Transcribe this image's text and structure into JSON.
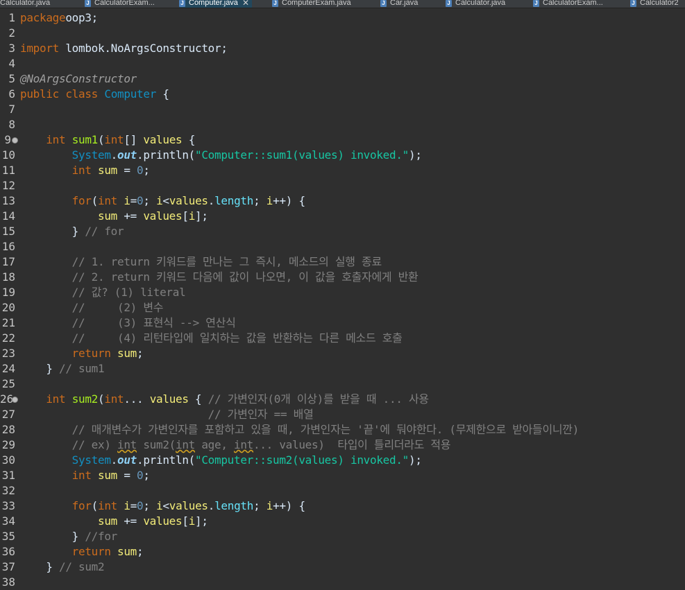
{
  "tabs": [
    {
      "label": "Calculator.java",
      "active": false,
      "icon": "java-file-icon"
    },
    {
      "label": "CalculatorExam...",
      "active": false,
      "icon": "java-file-icon"
    },
    {
      "label": "Computer.java",
      "active": true,
      "icon": "java-file-icon"
    },
    {
      "label": "ComputerExam.java",
      "active": false,
      "icon": "java-file-icon"
    },
    {
      "label": "Car.java",
      "active": false,
      "icon": "java-file-icon"
    },
    {
      "label": "Calculator.java",
      "active": false,
      "icon": "java-file-icon"
    },
    {
      "label": "CalculatorExam...",
      "active": false,
      "icon": "java-file-icon"
    },
    {
      "label": "Calculator2",
      "active": false,
      "icon": "java-file-icon"
    }
  ],
  "close_glyph": "✕",
  "colors": {
    "background": "#2f2f2f",
    "keyword": "#cc6c1d",
    "type": "#1290c3",
    "string": "#17c6a3",
    "comment": "#808080",
    "active_tab": "#22475c"
  },
  "editor": {
    "lines": [
      {
        "n": "1",
        "segs": [
          [
            "kw",
            "package"
          ],
          [
            "",
            "oop3;"
          ]
        ]
      },
      {
        "n": "2",
        "segs": []
      },
      {
        "n": "3",
        "segs": [
          [
            "kw",
            "import"
          ],
          [
            "",
            " lombok.NoArgsConstructor;"
          ]
        ]
      },
      {
        "n": "4",
        "segs": []
      },
      {
        "n": "5",
        "segs": [
          [
            "an",
            "@NoArgsConstructor"
          ]
        ]
      },
      {
        "n": "6",
        "segs": [
          [
            "kw",
            "public"
          ],
          [
            "",
            " "
          ],
          [
            "kw",
            "class"
          ],
          [
            "",
            " "
          ],
          [
            "ty",
            "Computer"
          ],
          [
            "",
            " {"
          ]
        ]
      },
      {
        "n": "7",
        "segs": []
      },
      {
        "n": "8",
        "segs": []
      },
      {
        "n": "9",
        "fold": true,
        "segs": [
          [
            "",
            "    "
          ],
          [
            "kw",
            "int"
          ],
          [
            "",
            " "
          ],
          [
            "mth",
            "sum1"
          ],
          [
            "",
            "("
          ],
          [
            "kw",
            "int"
          ],
          [
            "",
            "[] "
          ],
          [
            "var",
            "values"
          ],
          [
            "",
            " {"
          ]
        ]
      },
      {
        "n": "10",
        "segs": [
          [
            "",
            "        "
          ],
          [
            "ty",
            "System"
          ],
          [
            "",
            "."
          ],
          [
            "sfld",
            "out"
          ],
          [
            "",
            ".println("
          ],
          [
            "str",
            "\"Computer::sum1(values) invoked.\""
          ],
          [
            "",
            ");"
          ]
        ]
      },
      {
        "n": "11",
        "segs": [
          [
            "",
            "        "
          ],
          [
            "kw",
            "int"
          ],
          [
            "",
            " "
          ],
          [
            "var",
            "sum"
          ],
          [
            "",
            " = "
          ],
          [
            "num",
            "0"
          ],
          [
            "",
            ";"
          ]
        ]
      },
      {
        "n": "12",
        "segs": []
      },
      {
        "n": "13",
        "segs": [
          [
            "",
            "        "
          ],
          [
            "kw",
            "for"
          ],
          [
            "",
            "("
          ],
          [
            "kw",
            "int"
          ],
          [
            "",
            " "
          ],
          [
            "var",
            "i"
          ],
          [
            "",
            "="
          ],
          [
            "num",
            "0"
          ],
          [
            "",
            "; "
          ],
          [
            "var",
            "i"
          ],
          [
            "",
            "<"
          ],
          [
            "var",
            "values"
          ],
          [
            "",
            "."
          ],
          [
            "fld",
            "length"
          ],
          [
            "",
            "; "
          ],
          [
            "var",
            "i"
          ],
          [
            "",
            "++) {"
          ]
        ]
      },
      {
        "n": "14",
        "segs": [
          [
            "",
            "            "
          ],
          [
            "var",
            "sum"
          ],
          [
            "",
            " += "
          ],
          [
            "var",
            "values"
          ],
          [
            "",
            "["
          ],
          [
            "var",
            "i"
          ],
          [
            "",
            "];"
          ]
        ]
      },
      {
        "n": "15",
        "segs": [
          [
            "",
            "        } "
          ],
          [
            "cm",
            "// for"
          ]
        ]
      },
      {
        "n": "16",
        "segs": []
      },
      {
        "n": "17",
        "segs": [
          [
            "",
            "        "
          ],
          [
            "cm",
            "// 1. return 키워드를 만나는 그 즉시, 메소드의 실행 종료"
          ]
        ]
      },
      {
        "n": "18",
        "segs": [
          [
            "",
            "        "
          ],
          [
            "cm",
            "// 2. return 키워드 다음에 값이 나오면, 이 값을 호출자에게 반환"
          ]
        ]
      },
      {
        "n": "19",
        "segs": [
          [
            "",
            "        "
          ],
          [
            "cm",
            "// 값? (1) literal"
          ]
        ]
      },
      {
        "n": "20",
        "segs": [
          [
            "",
            "        "
          ],
          [
            "cm",
            "//     (2) 변수"
          ]
        ]
      },
      {
        "n": "21",
        "segs": [
          [
            "",
            "        "
          ],
          [
            "cm",
            "//     (3) 표현식 --> 연산식"
          ]
        ]
      },
      {
        "n": "22",
        "segs": [
          [
            "",
            "        "
          ],
          [
            "cm",
            "//     (4) 리턴타입에 일치하는 값을 반환하는 다른 메소드 호출"
          ]
        ]
      },
      {
        "n": "23",
        "segs": [
          [
            "",
            "        "
          ],
          [
            "kw",
            "return"
          ],
          [
            "",
            " "
          ],
          [
            "var",
            "sum"
          ],
          [
            "",
            ";"
          ]
        ]
      },
      {
        "n": "24",
        "segs": [
          [
            "",
            "    } "
          ],
          [
            "cm",
            "// sum1"
          ]
        ]
      },
      {
        "n": "25",
        "segs": []
      },
      {
        "n": "26",
        "fold": true,
        "segs": [
          [
            "",
            "    "
          ],
          [
            "kw",
            "int"
          ],
          [
            "",
            " "
          ],
          [
            "mth",
            "sum2"
          ],
          [
            "",
            "("
          ],
          [
            "kw",
            "int"
          ],
          [
            "",
            "... "
          ],
          [
            "var",
            "values"
          ],
          [
            "",
            " { "
          ],
          [
            "cm",
            "// 가변인자(0개 이상)를 받을 때 ... 사용"
          ]
        ]
      },
      {
        "n": "27",
        "segs": [
          [
            "",
            "                             "
          ],
          [
            "cm",
            "// 가변인자 == 배열"
          ]
        ]
      },
      {
        "n": "28",
        "segs": [
          [
            "",
            "        "
          ],
          [
            "cm",
            "// 매개변수가 가변인자를 포함하고 있을 때, 가변인자는 '끝'에 둬야한다. (무제한으로 받아들이니깐)"
          ]
        ]
      },
      {
        "n": "29",
        "segs": [
          [
            "",
            "        "
          ],
          [
            "cm",
            "// ex) "
          ],
          [
            "cm squig",
            "int"
          ],
          [
            "cm",
            " sum2("
          ],
          [
            "cm squig",
            "int"
          ],
          [
            "cm",
            " age, "
          ],
          [
            "cm squig",
            "int"
          ],
          [
            "cm",
            "... values)  타입이 틀리더라도 적용"
          ]
        ]
      },
      {
        "n": "30",
        "segs": [
          [
            "",
            "        "
          ],
          [
            "ty",
            "System"
          ],
          [
            "",
            "."
          ],
          [
            "sfld",
            "out"
          ],
          [
            "",
            ".println("
          ],
          [
            "str",
            "\"Computer::sum2(values) invoked.\""
          ],
          [
            "",
            ");"
          ]
        ]
      },
      {
        "n": "31",
        "segs": [
          [
            "",
            "        "
          ],
          [
            "kw",
            "int"
          ],
          [
            "",
            " "
          ],
          [
            "var",
            "sum"
          ],
          [
            "",
            " = "
          ],
          [
            "num",
            "0"
          ],
          [
            "",
            ";"
          ]
        ]
      },
      {
        "n": "32",
        "segs": []
      },
      {
        "n": "33",
        "segs": [
          [
            "",
            "        "
          ],
          [
            "kw",
            "for"
          ],
          [
            "",
            "("
          ],
          [
            "kw",
            "int"
          ],
          [
            "",
            " "
          ],
          [
            "var",
            "i"
          ],
          [
            "",
            "="
          ],
          [
            "num",
            "0"
          ],
          [
            "",
            "; "
          ],
          [
            "var",
            "i"
          ],
          [
            "",
            "<"
          ],
          [
            "var",
            "values"
          ],
          [
            "",
            "."
          ],
          [
            "fld",
            "length"
          ],
          [
            "",
            "; "
          ],
          [
            "var",
            "i"
          ],
          [
            "",
            "++) {"
          ]
        ]
      },
      {
        "n": "34",
        "segs": [
          [
            "",
            "            "
          ],
          [
            "var",
            "sum"
          ],
          [
            "",
            " += "
          ],
          [
            "var",
            "values"
          ],
          [
            "",
            "["
          ],
          [
            "var",
            "i"
          ],
          [
            "",
            "];"
          ]
        ]
      },
      {
        "n": "35",
        "segs": [
          [
            "",
            "        } "
          ],
          [
            "cm",
            "//for"
          ]
        ]
      },
      {
        "n": "36",
        "segs": [
          [
            "",
            "        "
          ],
          [
            "kw",
            "return"
          ],
          [
            "",
            " "
          ],
          [
            "var",
            "sum"
          ],
          [
            "",
            ";"
          ]
        ]
      },
      {
        "n": "37",
        "segs": [
          [
            "",
            "    } "
          ],
          [
            "cm",
            "// sum2"
          ]
        ]
      },
      {
        "n": "38",
        "segs": []
      }
    ]
  }
}
